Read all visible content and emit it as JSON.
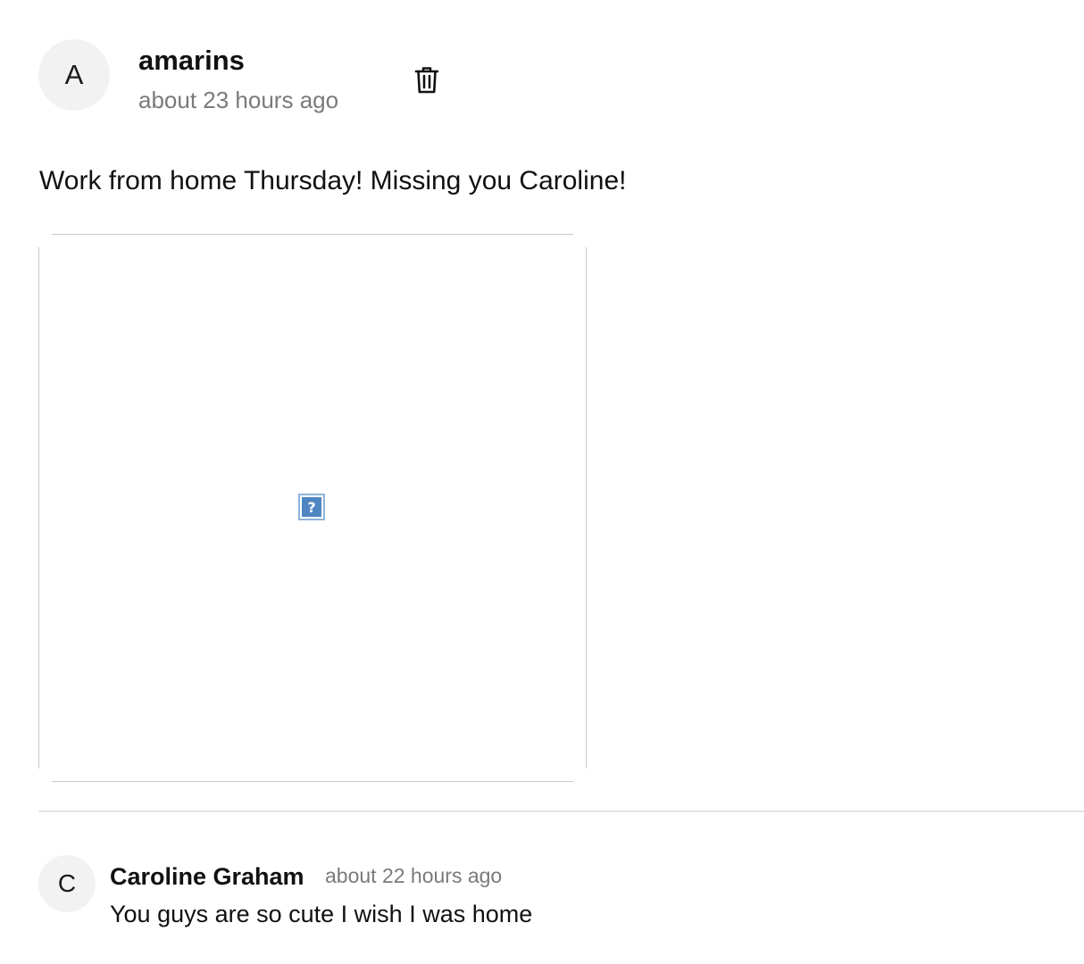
{
  "post": {
    "author_initial": "A",
    "author": "amarins",
    "timestamp": "about 23 hours ago",
    "delete_icon": "trash-icon",
    "text": "Work from home Thursday! Missing you Caroline!",
    "media": {
      "broken_image_glyph": "?",
      "icon": "broken-image-icon"
    }
  },
  "comments": [
    {
      "author_initial": "C",
      "author": "Caroline Graham",
      "timestamp": "about 22 hours ago",
      "text": "You guys are so cute I wish I was home"
    }
  ],
  "colors": {
    "avatar_bg": "#f2f2f2",
    "muted_text": "#7a7a7a",
    "divider": "#e3e3e3",
    "broken_icon_blue": "#4f86c2"
  }
}
